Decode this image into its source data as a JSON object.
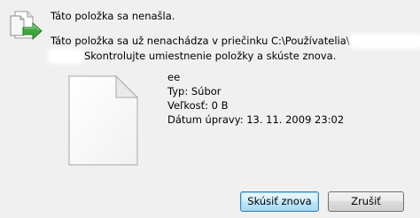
{
  "dialog": {
    "title_message": "Táto položka sa nenašla.",
    "message_line1_prefix": "Táto položka sa už nenachádza v priečinku C:\\Používatelia\\",
    "message_line2_suffix": "Skontrolujte umiestnenie položky a skúste znova.",
    "icon": "file-move-arrow-icon"
  },
  "file": {
    "icon": "blank-document-icon",
    "name": "ee",
    "type": "Typ: Súbor",
    "size": "Veľkosť: 0 B",
    "modified": "Dátum úpravy: 13. 11. 2009 23:02"
  },
  "buttons": {
    "retry": "Skúsiť znova",
    "cancel": "Zrušiť"
  },
  "colors": {
    "background": "#f0f0f0",
    "arrow_green": "#3ca63c",
    "primary_button_border": "#3c7fb1"
  }
}
